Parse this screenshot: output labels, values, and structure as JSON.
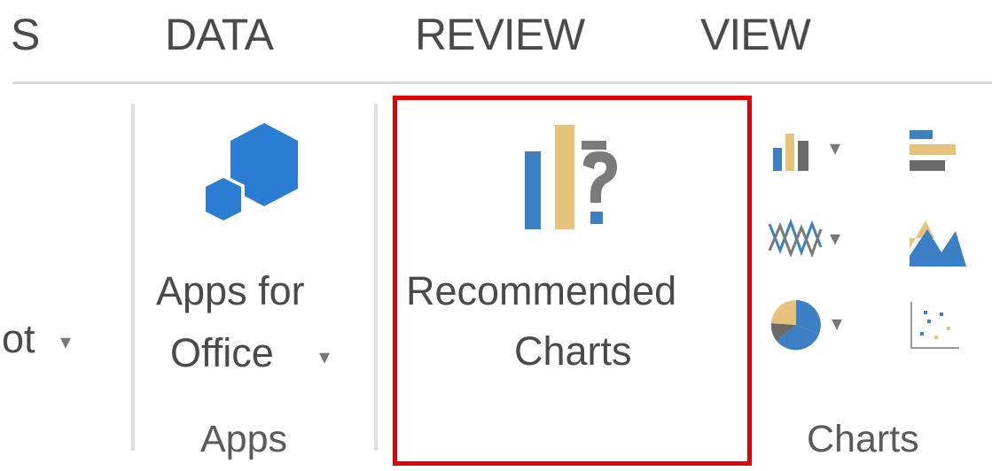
{
  "tabs": [
    {
      "label": "S"
    },
    {
      "label": "DATA"
    },
    {
      "label": "REVIEW"
    },
    {
      "label": "VIEW"
    }
  ],
  "ribbon": {
    "pivot_fragment": "ot",
    "apps_for_office": {
      "line1": "Apps for",
      "line2": "Office",
      "icon": "apps-for-office-icon"
    },
    "recommended_charts": {
      "line1": "Recommended",
      "line2": "Charts",
      "icon": "recommended-charts-icon"
    },
    "groups": {
      "apps": "Apps",
      "charts": "Charts"
    },
    "chart_buttons": [
      {
        "icon": "column-chart-icon"
      },
      {
        "icon": "bar-chart-icon"
      },
      {
        "icon": "line-chart-icon"
      },
      {
        "icon": "area-chart-icon"
      },
      {
        "icon": "pie-chart-icon"
      },
      {
        "icon": "scatter-chart-icon"
      }
    ]
  },
  "colors": {
    "accent_blue": "#2b7cd3",
    "chart_tan": "#e6c27a",
    "chart_grey": "#7a7a7a",
    "highlight_red": "#e00000"
  }
}
